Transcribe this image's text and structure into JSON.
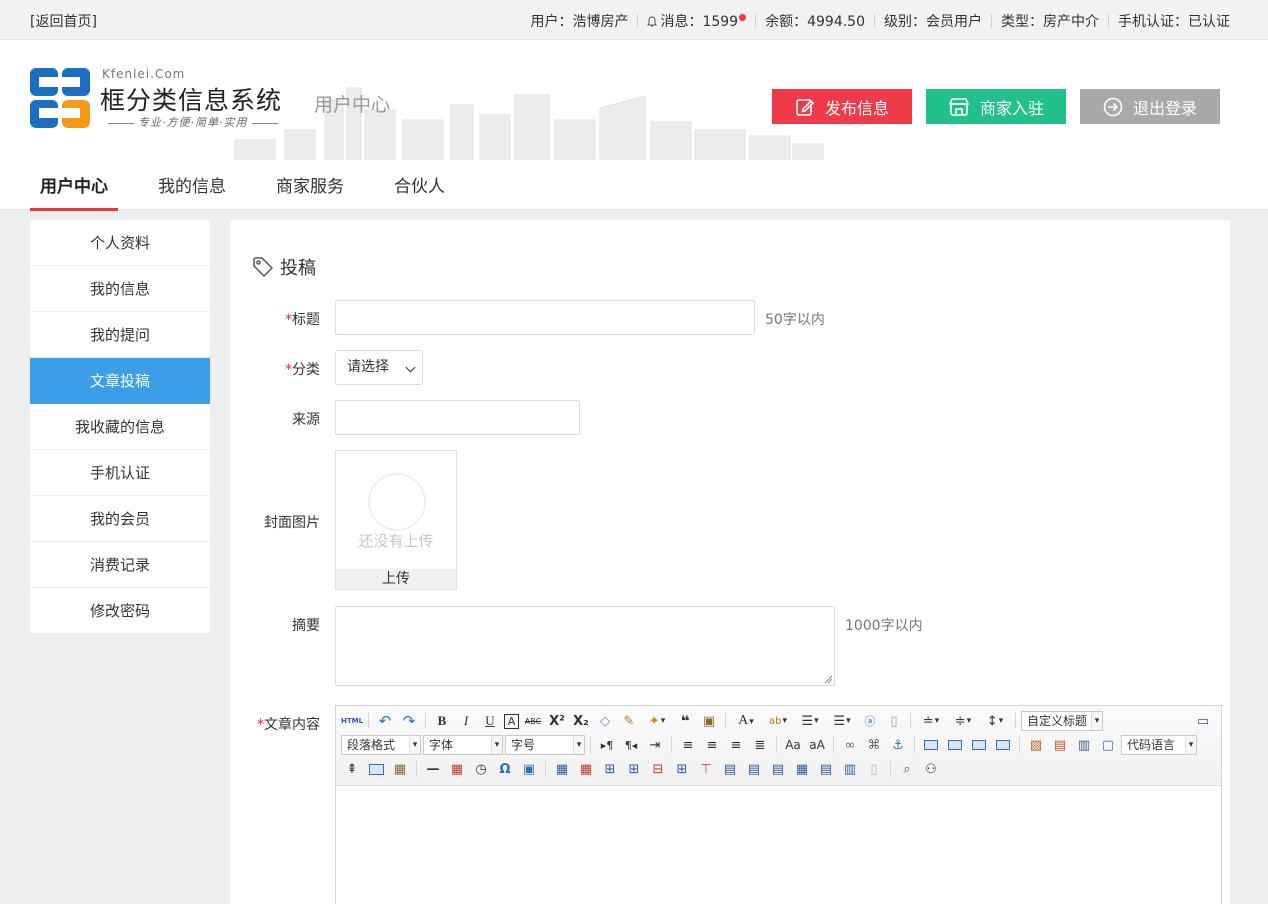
{
  "topbar": {
    "home": "[返回首页]",
    "user": "用户：浩博房产",
    "messages": "消息：1599",
    "balance": "余额：4994.50",
    "level": "级别：会员用户",
    "type": "类型：房产中介",
    "phone": "手机认证：已认证"
  },
  "brand": {
    "en": "Kfenlei.Com",
    "cn": "框分类信息系统",
    "slogan": "专业·方便·简单·实用",
    "section": "用户中心"
  },
  "header_buttons": {
    "publish": "发布信息",
    "merchant": "商家入驻",
    "logout": "退出登录"
  },
  "colors": {
    "publish": "#ef3b49",
    "merchant": "#22c08b",
    "logout": "#a9a9a9",
    "sidebar_active": "#3a9ee8",
    "nav_underline": "#e8363f"
  },
  "nav": [
    "用户中心",
    "我的信息",
    "商家服务",
    "合伙人"
  ],
  "sidebar": [
    "个人资料",
    "我的信息",
    "我的提问",
    "文章投稿",
    "我收藏的信息",
    "手机认证",
    "我的会员",
    "消费记录",
    "修改密码"
  ],
  "form": {
    "section_title": "投稿",
    "title_label": "标题",
    "title_hint": "50字以内",
    "category_label": "分类",
    "category_selected": "请选择",
    "source_label": "来源",
    "cover_label": "封面图片",
    "cover_empty": "还没有上传",
    "cover_upload": "上传",
    "summary_label": "摘要",
    "summary_hint": "1000字以内",
    "content_label": "文章内容",
    "required_mark": "*"
  },
  "editor": {
    "html_btn": "HTML",
    "custom_heading": "自定义标题",
    "paragraph_format": "段落格式",
    "font_family": "字体",
    "font_size": "字号",
    "code_language": "代码语言"
  }
}
